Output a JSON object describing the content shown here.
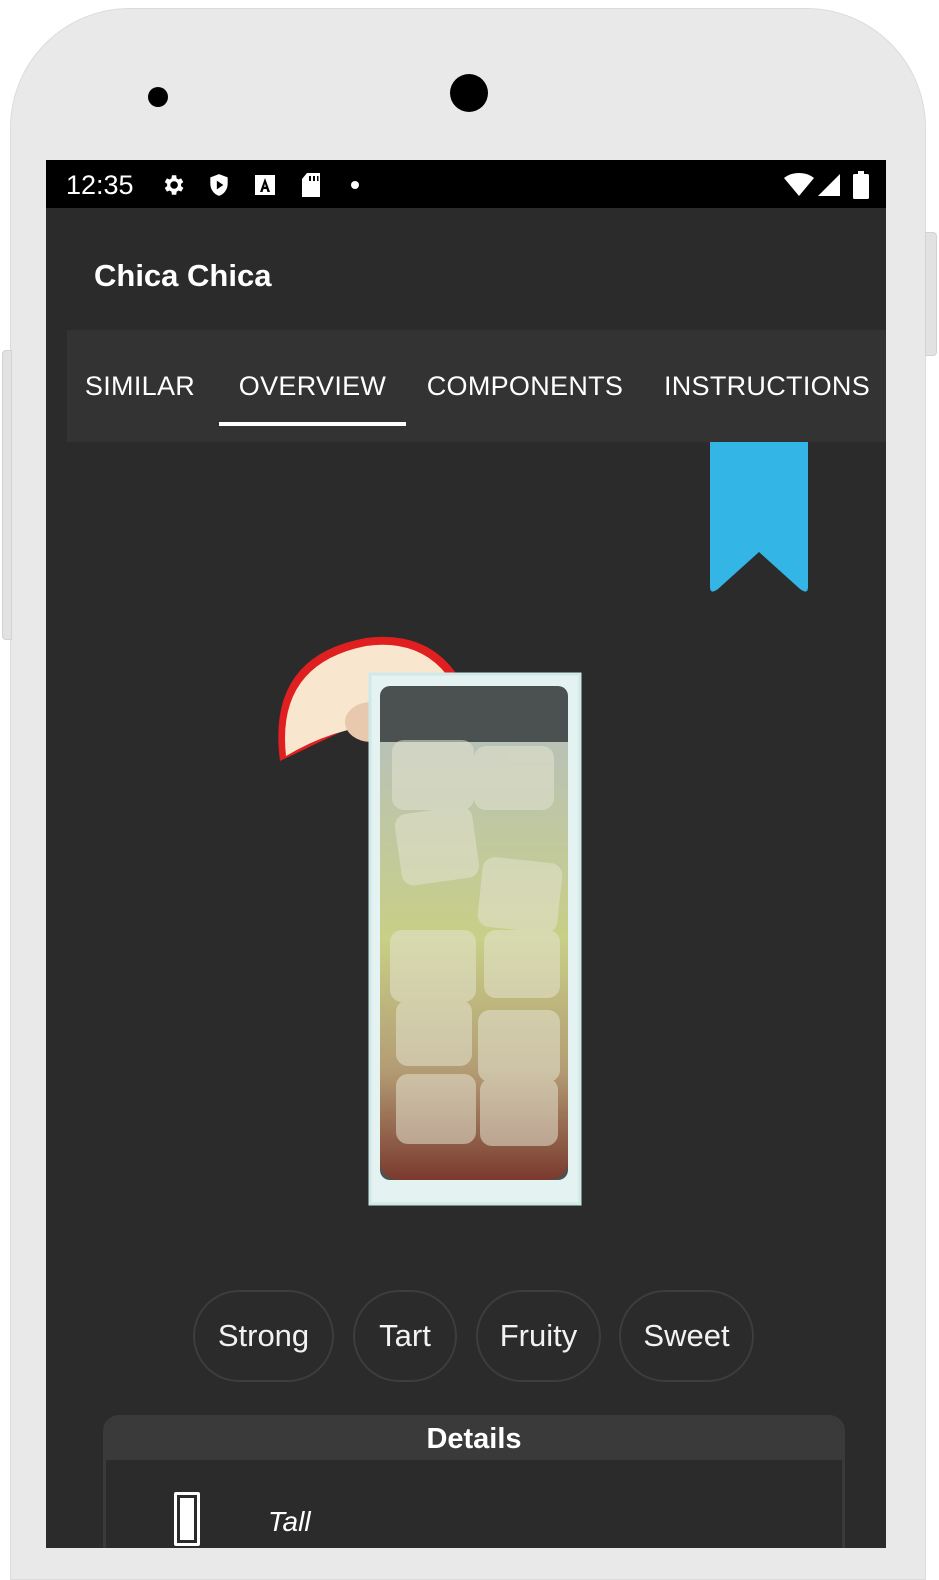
{
  "status_bar": {
    "time": "12:35",
    "icons": [
      "gear-icon",
      "shield-play-icon",
      "text-a-icon",
      "sd-card-icon",
      "dot-icon",
      "wifi-icon",
      "signal-icon",
      "battery-icon"
    ]
  },
  "app_bar": {
    "title": "Chica Chica"
  },
  "tabs": [
    {
      "label": "SIMILAR",
      "selected": false
    },
    {
      "label": "OVERVIEW",
      "selected": true
    },
    {
      "label": "COMPONENTS",
      "selected": false
    },
    {
      "label": "INSTRUCTIONS",
      "selected": false
    }
  ],
  "bookmark": {
    "icon": "bookmark-icon",
    "color": "#33b5e5"
  },
  "drink_illustration": {
    "glass": "tall",
    "garnish": "apple-slice-icon"
  },
  "flavor_tags": [
    "Strong",
    "Tart",
    "Fruity",
    "Sweet"
  ],
  "details": {
    "header": "Details",
    "glass_type": "Tall",
    "glass_icon": "tall-glass-icon"
  },
  "colors": {
    "accent": "#33b5e5",
    "background": "#2b2b2b",
    "tab_bar": "#333333"
  }
}
